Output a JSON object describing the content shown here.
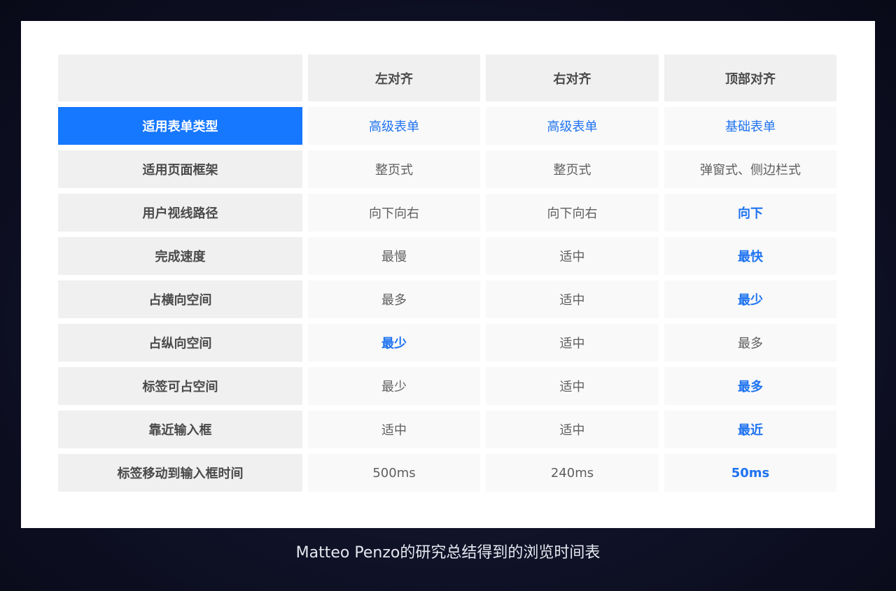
{
  "table": {
    "headers": [
      "",
      "左对齐",
      "右对齐",
      "顶部对齐"
    ],
    "rows": [
      {
        "label": "适用表单类型",
        "values": [
          "高级表单",
          "高级表单",
          "基础表单"
        ]
      },
      {
        "label": "适用页面框架",
        "values": [
          "整页式",
          "整页式",
          "弹窗式、侧边栏式"
        ]
      },
      {
        "label": "用户视线路径",
        "values": [
          "向下向右",
          "向下向右",
          "向下"
        ]
      },
      {
        "label": "完成速度",
        "values": [
          "最慢",
          "适中",
          "最快"
        ]
      },
      {
        "label": "占横向空间",
        "values": [
          "最多",
          "适中",
          "最少"
        ]
      },
      {
        "label": "占纵向空间",
        "values": [
          "最少",
          "适中",
          "最多"
        ]
      },
      {
        "label": "标签可占空间",
        "values": [
          "最少",
          "适中",
          "最多"
        ]
      },
      {
        "label": "靠近输入框",
        "values": [
          "适中",
          "适中",
          "最近"
        ]
      },
      {
        "label": "标签移动到输入框时间",
        "values": [
          "500ms",
          "240ms",
          "50ms"
        ]
      }
    ]
  },
  "caption": "Matteo Penzo的研究总结得到的浏览时间表",
  "colors": {
    "accent": "#1677ff",
    "highlight_text": "#1f73f0",
    "label_bg": "#f0f0f0",
    "value_bg": "#f9f9f9",
    "page_bg": "#0f1126"
  }
}
